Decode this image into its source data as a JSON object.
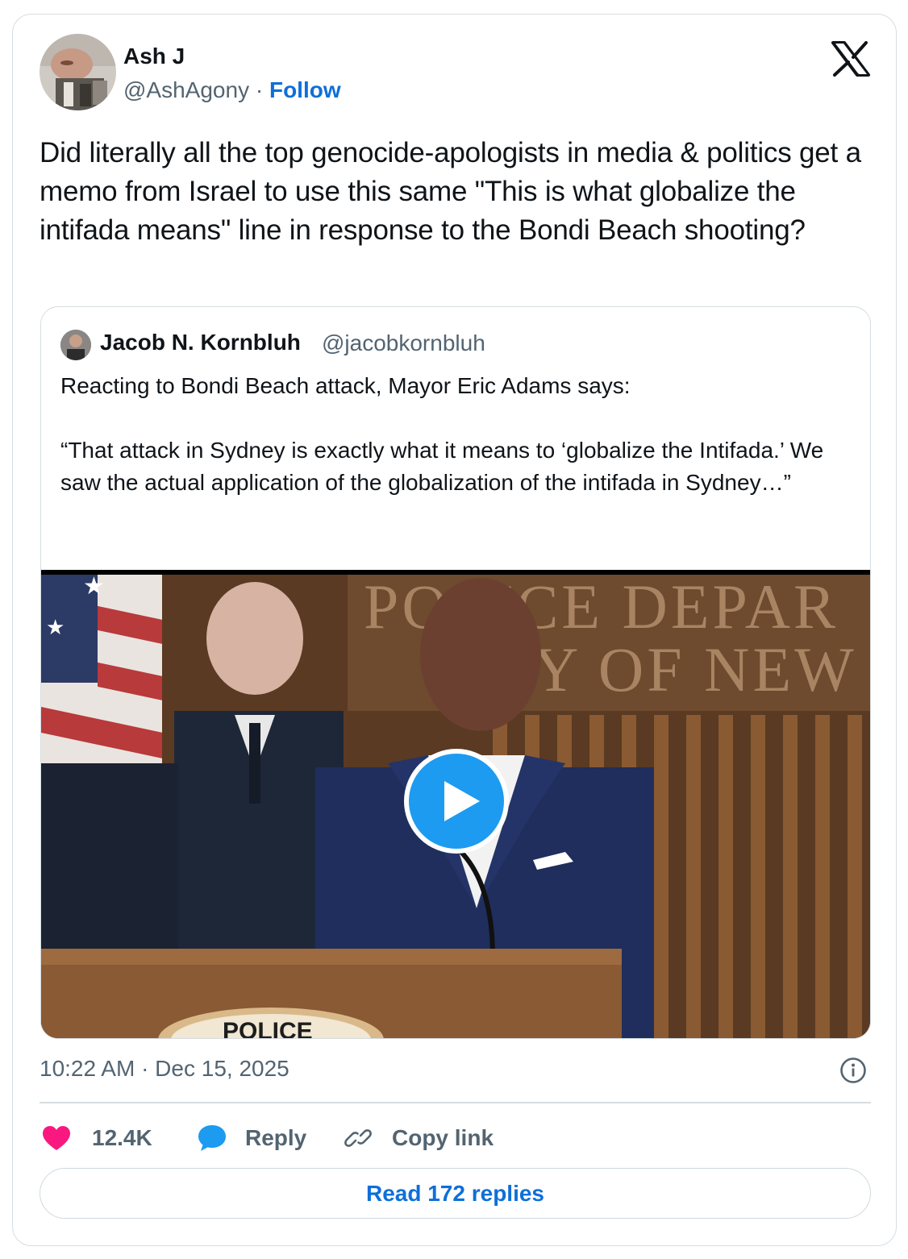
{
  "tweet": {
    "author": {
      "name": "Ash J",
      "handle": "@AshAgony",
      "separator": "·",
      "follow_label": "Follow"
    },
    "text": "Did literally all the top genocide-apologists in media & politics get a memo from Israel to use this same \"This is what globalize the intifada means\" line in response to the Bondi Beach shooting?",
    "quoted": {
      "author_name": "Jacob N. Kornbluh",
      "author_handle": "@jacobkornbluh",
      "text_line1": "Reacting to Bondi Beach attack, Mayor Eric Adams says:",
      "text_line2": "“That attack in Sydney is exactly what it means to ‘globalize the Intifada.’ We saw the actual application of the globalization of the intifada in Sydney…”",
      "video": {
        "sign_line1": "POLICE DEPAR",
        "sign_line2": "Y OF NEW",
        "podium_text": "POLICE"
      }
    },
    "timestamp": "10:22 AM · Dec 15, 2025",
    "actions": {
      "likes": "12.4K",
      "reply_label": "Reply",
      "copy_label": "Copy link"
    },
    "read_replies_label": "Read 172 replies"
  },
  "icons": {
    "brand": "x-logo-icon",
    "like": "heart-icon",
    "reply": "speech-bubble-icon",
    "copy": "link-icon",
    "info": "info-icon",
    "play": "play-icon"
  },
  "colors": {
    "link_blue": "#0e6fd8",
    "like_pink": "#f91880",
    "reply_blue": "#1d9bf0",
    "muted": "#536471",
    "border": "#d6dde2"
  }
}
